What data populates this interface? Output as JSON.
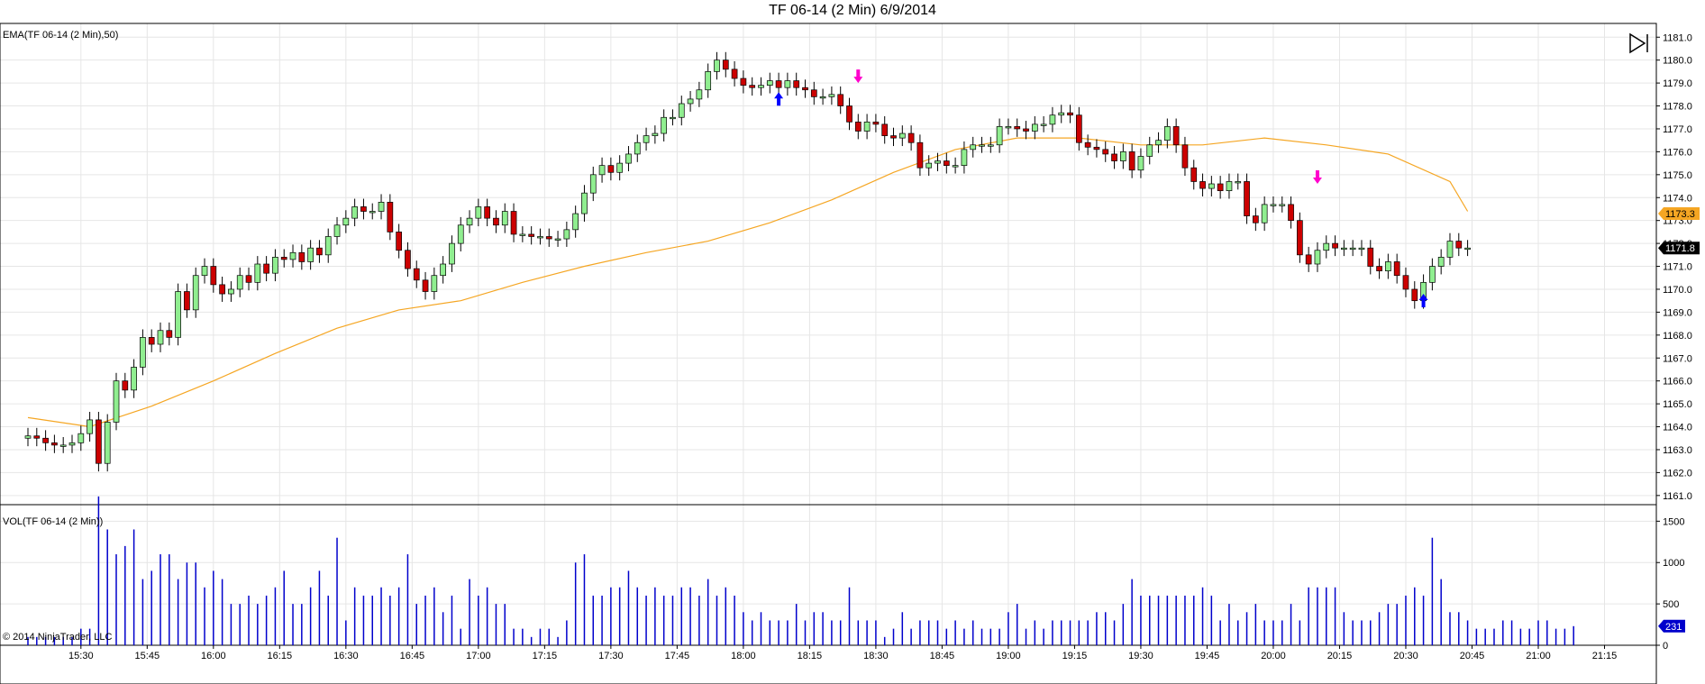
{
  "title": "TF 06-14 (2 Min)  6/9/2014",
  "copyright": "© 2014 NinjaTrader, LLC",
  "colors": {
    "up_candle": "#90EE90",
    "down_candle": "#CC0000",
    "ema_line": "#F5A623",
    "volume": "#0000CC",
    "grid": "#E6E6E6",
    "buy_marker": "#0000FF",
    "sell_marker": "#FF00CC",
    "ema_badge": "#F5A623",
    "price_badge": "#000000",
    "vol_badge": "#0000CC"
  },
  "icons": {
    "toolbar": "play-step-icon"
  },
  "chart_data": [
    {
      "type": "candlestick",
      "label": "EMA(TF 06-14 (2 Min),50)",
      "ylim": [
        1160.6,
        1181.6
      ],
      "y_ticks": [
        "1181.0",
        "1180.0",
        "1179.0",
        "1178.0",
        "1177.0",
        "1176.0",
        "1175.0",
        "1174.0",
        "1173.0",
        "1172.0",
        "1171.0",
        "1170.0",
        "1169.0",
        "1168.0",
        "1167.0",
        "1166.0",
        "1165.0",
        "1164.0",
        "1163.0",
        "1162.0",
        "1161.0"
      ],
      "x_ticks": [
        "15:30",
        "15:45",
        "16:00",
        "16:15",
        "16:30",
        "16:45",
        "17:00",
        "17:15",
        "17:30",
        "17:45",
        "18:00",
        "18:15",
        "18:30",
        "18:45",
        "19:00",
        "19:15",
        "19:30",
        "19:45",
        "20:00",
        "20:15",
        "20:30",
        "20:45",
        "21:00",
        "21:15"
      ],
      "time_range": [
        "15:28",
        "21:20"
      ],
      "start_time": "15:18",
      "interval_min": 2,
      "closes": [
        1163.6,
        1163.5,
        1163.3,
        1163.2,
        1163.2,
        1163.3,
        1163.7,
        1164.3,
        1162.4,
        1164.2,
        1166.0,
        1165.6,
        1166.6,
        1167.9,
        1167.6,
        1168.2,
        1167.9,
        1169.9,
        1169.1,
        1170.6,
        1171.0,
        1170.2,
        1169.8,
        1170.0,
        1170.6,
        1170.3,
        1171.1,
        1170.7,
        1171.4,
        1171.3,
        1171.6,
        1171.2,
        1171.8,
        1171.5,
        1172.3,
        1172.8,
        1173.1,
        1173.6,
        1173.4,
        1173.4,
        1173.8,
        1172.5,
        1171.7,
        1170.9,
        1170.4,
        1169.9,
        1170.6,
        1171.1,
        1172.0,
        1172.8,
        1173.1,
        1173.6,
        1173.1,
        1172.8,
        1173.4,
        1172.4,
        1172.4,
        1172.3,
        1172.3,
        1172.2,
        1172.2,
        1172.6,
        1173.3,
        1174.2,
        1175.0,
        1175.4,
        1175.1,
        1175.5,
        1175.9,
        1176.4,
        1176.7,
        1176.8,
        1177.5,
        1177.5,
        1178.1,
        1178.3,
        1178.7,
        1179.5,
        1180.0,
        1179.6,
        1179.2,
        1178.9,
        1178.8,
        1178.9,
        1179.1,
        1178.8,
        1179.1,
        1178.8,
        1178.7,
        1178.4,
        1178.4,
        1178.5,
        1178.0,
        1177.3,
        1176.9,
        1177.3,
        1177.2,
        1176.7,
        1176.6,
        1176.8,
        1176.4,
        1175.3,
        1175.5,
        1175.6,
        1175.4,
        1175.4,
        1176.1,
        1176.3,
        1176.3,
        1176.3,
        1177.1,
        1177.1,
        1177.0,
        1176.9,
        1177.2,
        1177.2,
        1177.6,
        1177.7,
        1177.6,
        1176.4,
        1176.2,
        1176.1,
        1175.9,
        1175.6,
        1176.0,
        1175.2,
        1175.8,
        1176.3,
        1176.5,
        1177.1,
        1176.3,
        1175.3,
        1174.7,
        1174.4,
        1174.6,
        1174.3,
        1174.7,
        1174.7,
        1173.2,
        1172.9,
        1173.7,
        1173.7,
        1173.7,
        1173.0,
        1171.5,
        1171.1,
        1171.7,
        1172.0,
        1171.8,
        1171.8,
        1171.8,
        1171.8,
        1171.0,
        1170.8,
        1171.2,
        1170.6,
        1170.0,
        1169.5,
        1170.3,
        1171.0,
        1171.4,
        1172.1,
        1171.8,
        1171.8
      ],
      "ema": [
        1164.4,
        1164.0,
        1164.9,
        1166.0,
        1167.2,
        1168.3,
        1169.1,
        1169.5,
        1170.3,
        1171.0,
        1171.6,
        1172.1,
        1172.9,
        1173.9,
        1175.1,
        1176.1,
        1176.6,
        1176.6,
        1176.3,
        1176.3,
        1176.6,
        1176.3,
        1175.9,
        1174.7,
        1173.4
      ],
      "markers": [
        {
          "type": "buy",
          "time": "18:08",
          "price": 1178.6
        },
        {
          "type": "sell",
          "time": "18:26",
          "price": 1179.0
        },
        {
          "type": "sell",
          "time": "20:10",
          "price": 1174.6
        },
        {
          "type": "buy",
          "time": "20:34",
          "price": 1169.8
        }
      ],
      "last_ema": "1173.3",
      "last_price": "1171.8"
    },
    {
      "type": "bar",
      "label": "VOL(TF 06-14 (2 Min))",
      "ylim": [
        0,
        1700
      ],
      "y_ticks": [
        "1500",
        "1000",
        "500",
        "0"
      ],
      "values": [
        100,
        100,
        100,
        100,
        100,
        100,
        200,
        200,
        1800,
        1400,
        1100,
        1200,
        1400,
        800,
        900,
        1100,
        1100,
        800,
        1000,
        1000,
        700,
        900,
        800,
        500,
        500,
        600,
        500,
        600,
        700,
        900,
        500,
        500,
        700,
        900,
        600,
        1300,
        300,
        700,
        600,
        600,
        700,
        600,
        700,
        1100,
        500,
        600,
        700,
        400,
        600,
        200,
        800,
        600,
        700,
        500,
        500,
        200,
        200,
        100,
        200,
        200,
        100,
        300,
        1000,
        1100,
        600,
        600,
        700,
        700,
        900,
        700,
        600,
        700,
        600,
        600,
        700,
        700,
        600,
        800,
        600,
        700,
        600,
        400,
        300,
        400,
        300,
        300,
        300,
        500,
        300,
        400,
        400,
        300,
        300,
        700,
        300,
        300,
        300,
        100,
        200,
        400,
        200,
        300,
        300,
        300,
        200,
        300,
        200,
        300,
        200,
        200,
        200,
        400,
        500,
        200,
        300,
        200,
        300,
        300,
        300,
        300,
        300,
        400,
        400,
        300,
        500,
        800,
        600,
        600,
        600,
        600,
        600,
        600,
        600,
        700,
        600,
        300,
        500,
        300,
        400,
        500,
        300,
        300,
        300,
        500,
        300,
        700,
        700,
        700,
        700,
        400,
        300,
        300,
        300,
        400,
        500,
        500,
        600,
        700,
        600,
        1300,
        800,
        400,
        400,
        300,
        200,
        200,
        200,
        300,
        300,
        200,
        200,
        300,
        300,
        200,
        200,
        231
      ],
      "last_volume": "231"
    }
  ]
}
